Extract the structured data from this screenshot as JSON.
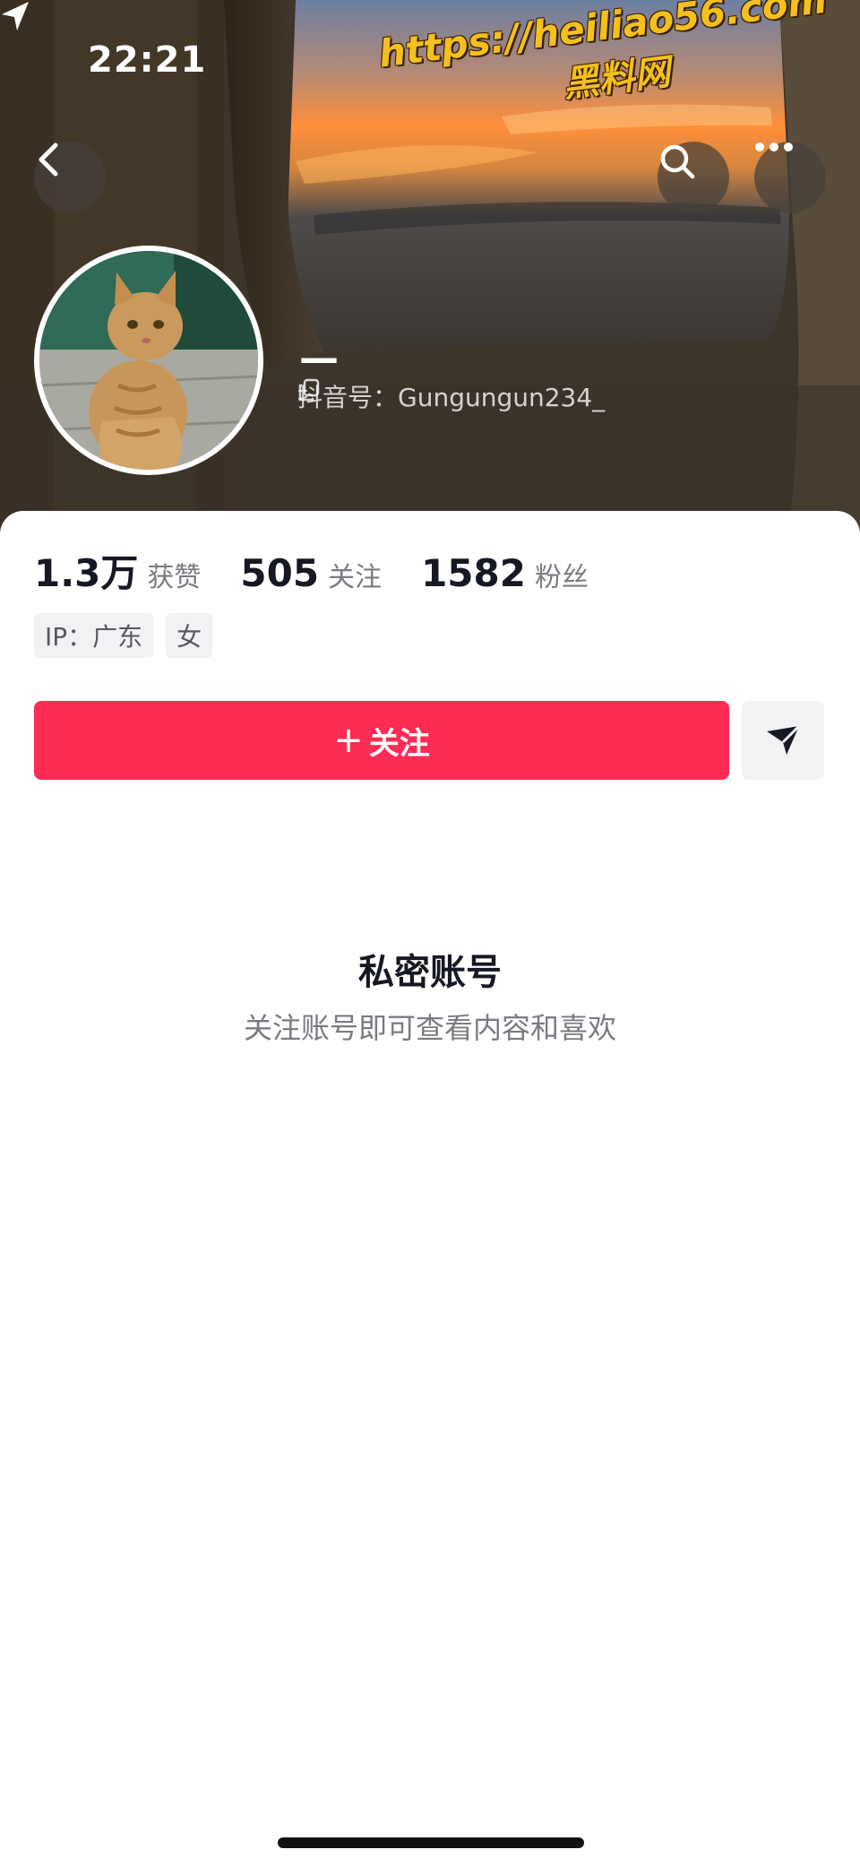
{
  "status_bar": {
    "time": "22:21"
  },
  "watermark": {
    "url": "https://heiliao56.com",
    "name": "黑料网"
  },
  "header": {
    "username": "—",
    "douyin_id": "抖音号：Gungungun234_"
  },
  "stats": [
    {
      "value": "1.3万",
      "label": "获赞"
    },
    {
      "value": "505",
      "label": "关注"
    },
    {
      "value": "1582",
      "label": "粉丝"
    }
  ],
  "tags": [
    {
      "text": "IP：广东"
    },
    {
      "text": "女"
    }
  ],
  "actions": {
    "follow_plus": "+",
    "follow_label": "关注"
  },
  "private": {
    "title": "私密账号",
    "subtitle": "关注账号即可查看内容和喜欢"
  },
  "colors": {
    "accent": "#fe2c55",
    "watermark": "#f4c01e"
  }
}
